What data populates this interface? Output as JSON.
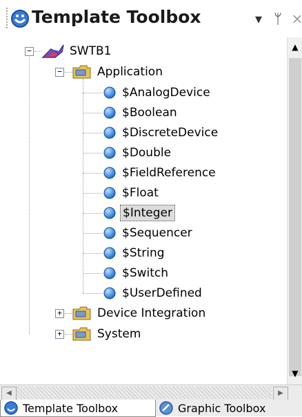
{
  "panel": {
    "title": "Template Toolbox",
    "dropdown_icon": "chevron-down-icon",
    "pin_icon": "pin-icon",
    "close_icon": "close-icon"
  },
  "tree": {
    "root": {
      "label": "SWTB1",
      "expanded": true
    },
    "folders": [
      {
        "label": "Application",
        "expanded": true,
        "items": [
          "$AnalogDevice",
          "$Boolean",
          "$DiscreteDevice",
          "$Double",
          "$FieldReference",
          "$Float",
          "$Integer",
          "$Sequencer",
          "$String",
          "$Switch",
          "$UserDefined"
        ]
      },
      {
        "label": "Device Integration",
        "expanded": false
      },
      {
        "label": "System",
        "expanded": false
      }
    ],
    "selected": "$Integer"
  },
  "tabs": [
    {
      "label": "Template Toolbox",
      "active": true
    },
    {
      "label": "Graphic Toolbox",
      "active": false
    }
  ],
  "colors": {
    "orb": "#1f6fd0",
    "folder": "#e8c35a",
    "selection": "#dcdcdc"
  }
}
